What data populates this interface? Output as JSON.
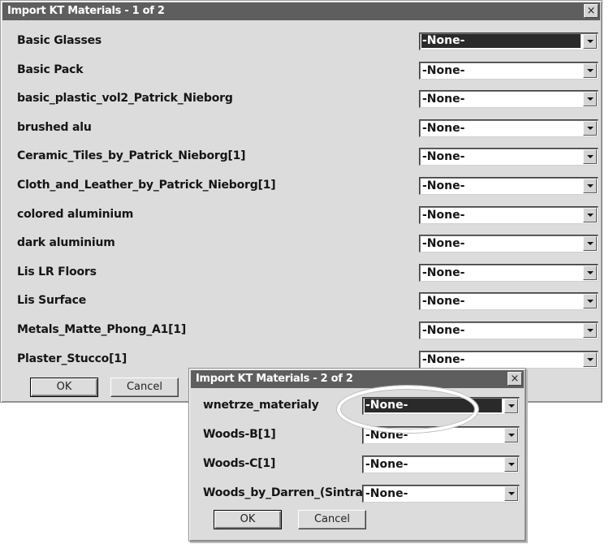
{
  "dialog1": {
    "title": "Import KT Materials - 1 of 2",
    "close_label": "×",
    "rows": [
      {
        "label": "Basic Glasses",
        "value": "-None-",
        "highlighted": true
      },
      {
        "label": "Basic Pack",
        "value": "-None-"
      },
      {
        "label": "basic_plastic_vol2_Patrick_Nieborg",
        "value": "-None-"
      },
      {
        "label": "brushed alu",
        "value": "-None-"
      },
      {
        "label": "Ceramic_Tiles_by_Patrick_Nieborg[1]",
        "value": "-None-"
      },
      {
        "label": "Cloth_and_Leather_by_Patrick_Nieborg[1]",
        "value": "-None-"
      },
      {
        "label": "colored aluminium",
        "value": "-None-"
      },
      {
        "label": "dark aluminium",
        "value": "-None-"
      },
      {
        "label": "Lis LR Floors",
        "value": "-None-"
      },
      {
        "label": "Lis Surface",
        "value": "-None-"
      },
      {
        "label": "Metals_Matte_Phong_A1[1]",
        "value": "-None-"
      },
      {
        "label": "Plaster_Stucco[1]",
        "value": "-None-"
      }
    ],
    "ok_label": "OK",
    "cancel_label": "Cancel"
  },
  "dialog2": {
    "title": "Import KT Materials - 2 of 2",
    "close_label": "×",
    "rows": [
      {
        "label": "wnetrze_materialy",
        "value": "-None-",
        "highlighted": true
      },
      {
        "label": "Woods-B[1]",
        "value": "-None-"
      },
      {
        "label": "Woods-C[1]",
        "value": "-None-"
      },
      {
        "label": "Woods_by_Darren_(Sintra)",
        "value": "-None-"
      }
    ],
    "ok_label": "OK",
    "cancel_label": "Cancel"
  },
  "colors": {
    "dialog_bg": "#dcdcdc",
    "titlebar_bg": "#5e5e5e",
    "highlight_bg": "#2a2a2a",
    "annotation_oval": "#ffffff"
  }
}
